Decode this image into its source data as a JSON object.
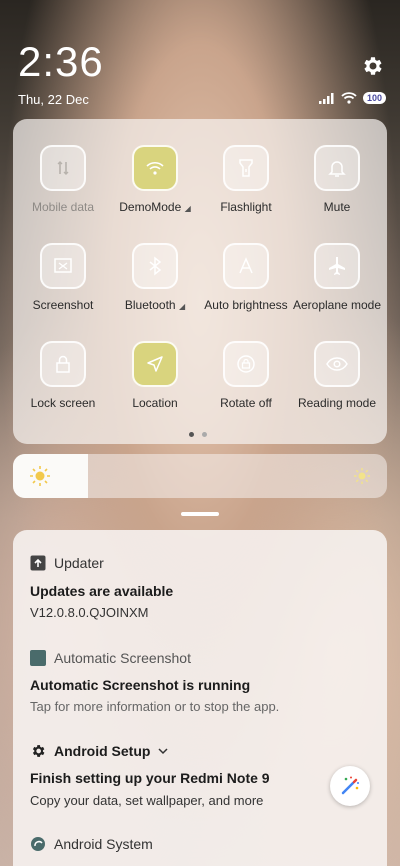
{
  "status_bar": {
    "time": "2:36",
    "date": "Thu, 22 Dec",
    "battery": "100"
  },
  "quick_settings": {
    "tiles": [
      {
        "label": "Mobile data",
        "icon": "mobile-data-icon",
        "state": "disabled"
      },
      {
        "label": "DemoMode",
        "icon": "wifi-icon",
        "state": "on"
      },
      {
        "label": "Flashlight",
        "icon": "flashlight-icon",
        "state": "off"
      },
      {
        "label": "Mute",
        "icon": "bell-icon",
        "state": "off"
      },
      {
        "label": "Screenshot",
        "icon": "screenshot-icon",
        "state": "off"
      },
      {
        "label": "Bluetooth",
        "icon": "bluetooth-icon",
        "state": "off"
      },
      {
        "label": "Auto brightness",
        "icon": "auto-brightness-icon",
        "state": "off"
      },
      {
        "label": "Aeroplane mode",
        "icon": "aeroplane-icon",
        "state": "off"
      },
      {
        "label": "Lock screen",
        "icon": "lock-icon",
        "state": "off"
      },
      {
        "label": "Location",
        "icon": "location-icon",
        "state": "on"
      },
      {
        "label": "Rotate off",
        "icon": "rotate-icon",
        "state": "off"
      },
      {
        "label": "Reading mode",
        "icon": "eye-icon",
        "state": "off"
      }
    ],
    "page": 1,
    "pages": 2
  },
  "brightness": {
    "level": 0.2
  },
  "notifications": {
    "updater": {
      "app": "Updater",
      "title": "Updates are available",
      "body": "V12.0.8.0.QJOINXM"
    },
    "screenshot": {
      "app": "Automatic Screenshot",
      "title": "Automatic Screenshot is running",
      "body": "Tap for more information or to stop the app."
    },
    "setup": {
      "app": "Android Setup",
      "title": "Finish setting up your Redmi Note 9",
      "body": "Copy your data, set wallpaper, and more"
    },
    "system": {
      "app": "Android System"
    }
  },
  "colors": {
    "tile_on": "#d9d47e"
  }
}
